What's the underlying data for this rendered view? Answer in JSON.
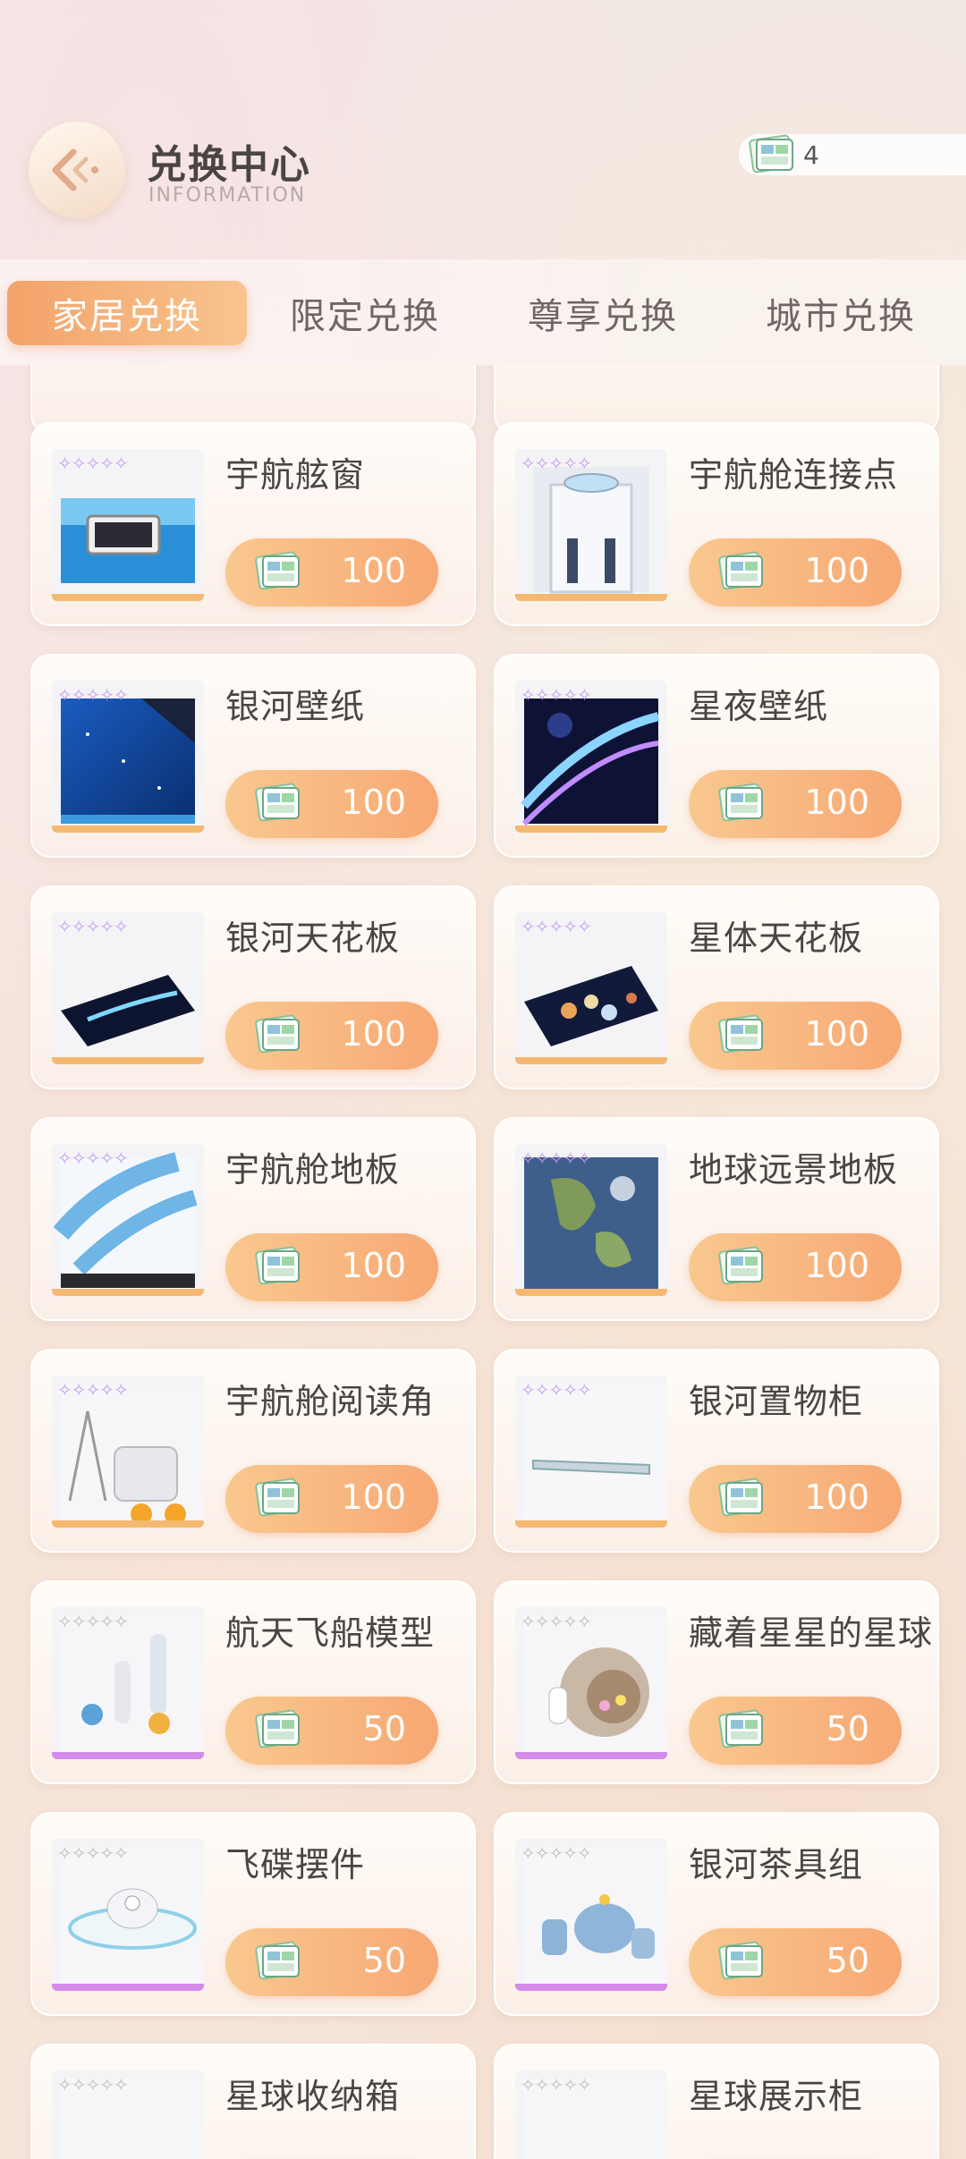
{
  "header": {
    "title": "兑换中心",
    "subtitle": "INFORMATION",
    "currency_value": "4"
  },
  "tabs": [
    {
      "label": "家居兑换",
      "active": true
    },
    {
      "label": "限定兑换",
      "active": false
    },
    {
      "label": "尊享兑换",
      "active": false
    },
    {
      "label": "城市兑换",
      "active": false
    }
  ],
  "items": [
    {
      "name": "宇航舷窗",
      "price": "100",
      "rarity": "rainbow",
      "thumb": "space-window"
    },
    {
      "name": "宇航舱连接点",
      "price": "100",
      "rarity": "rainbow",
      "thumb": "connector"
    },
    {
      "name": "银河壁纸",
      "price": "100",
      "rarity": "rainbow",
      "thumb": "galaxy-wallpaper"
    },
    {
      "name": "星夜壁纸",
      "price": "100",
      "rarity": "rainbow",
      "thumb": "starnight-wallpaper"
    },
    {
      "name": "银河天花板",
      "price": "100",
      "rarity": "rainbow",
      "thumb": "galaxy-ceiling"
    },
    {
      "name": "星体天花板",
      "price": "100",
      "rarity": "rainbow",
      "thumb": "planet-ceiling"
    },
    {
      "name": "宇航舱地板",
      "price": "100",
      "rarity": "rainbow",
      "thumb": "cabin-floor"
    },
    {
      "name": "地球远景地板",
      "price": "100",
      "rarity": "rainbow",
      "thumb": "earth-floor"
    },
    {
      "name": "宇航舱阅读角",
      "price": "100",
      "rarity": "rainbow",
      "thumb": "reading-corner"
    },
    {
      "name": "银河置物柜",
      "price": "100",
      "rarity": "rainbow",
      "thumb": "shelf"
    },
    {
      "name": "航天飞船模型",
      "price": "50",
      "rarity": "plain",
      "thumb": "rocket-model"
    },
    {
      "name": "藏着星星的星球",
      "price": "50",
      "rarity": "plain",
      "thumb": "star-planet"
    },
    {
      "name": "飞碟摆件",
      "price": "50",
      "rarity": "plain",
      "thumb": "ufo"
    },
    {
      "name": "银河茶具组",
      "price": "50",
      "rarity": "plain",
      "thumb": "tea-set"
    },
    {
      "name": "星球收纳箱",
      "price": "",
      "rarity": "plain",
      "thumb": "storage-box"
    },
    {
      "name": "星球展示柜",
      "price": "",
      "rarity": "plain",
      "thumb": "display-case"
    }
  ],
  "colors": {
    "accent": "#f7a873",
    "text": "#4a4444",
    "rainbow_bar": "#f5b870",
    "plain_bar": "#d48ae8"
  }
}
